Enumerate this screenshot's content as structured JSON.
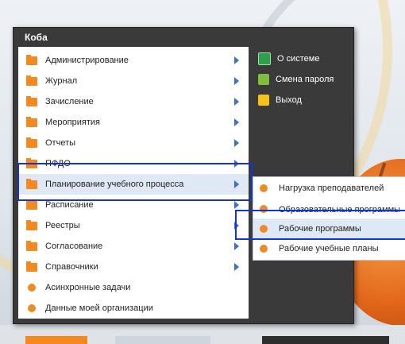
{
  "menu": {
    "title": "Коба",
    "items": [
      {
        "label": "Администрирование",
        "icon": "folder-icon",
        "arrow": true
      },
      {
        "label": "Журнал",
        "icon": "folder-icon",
        "arrow": true
      },
      {
        "label": "Зачисление",
        "icon": "folder-icon",
        "arrow": true
      },
      {
        "label": "Мероприятия",
        "icon": "folder-icon",
        "arrow": true
      },
      {
        "label": "Отчеты",
        "icon": "folder-icon",
        "arrow": true
      },
      {
        "label": "ПФДО",
        "icon": "folder-icon",
        "arrow": true
      },
      {
        "label": "Планирование учебного процесса",
        "icon": "folder-icon",
        "arrow": true,
        "highlighted": true
      },
      {
        "label": "Расписание",
        "icon": "folder-icon",
        "arrow": true
      },
      {
        "label": "Реестры",
        "icon": "folder-icon",
        "arrow": true
      },
      {
        "label": "Согласование",
        "icon": "folder-icon",
        "arrow": true
      },
      {
        "label": "Справочники",
        "icon": "folder-icon",
        "arrow": true
      },
      {
        "label": "Асинхронные задачи",
        "icon": "dot-icon",
        "arrow": false
      },
      {
        "label": "Данные моей организации",
        "icon": "dot-icon",
        "arrow": false
      }
    ],
    "right_items": [
      {
        "label": "О системе",
        "icon": "monitor-icon"
      },
      {
        "label": "Смена пароля",
        "icon": "users-icon"
      },
      {
        "label": "Выход",
        "icon": "key-icon"
      }
    ]
  },
  "submenu": {
    "items": [
      {
        "label": "Нагрузка преподавателей"
      },
      {
        "label": "Образовательные программы"
      },
      {
        "label": "Рабочие программы",
        "highlighted": true
      },
      {
        "label": "Рабочие учебные планы"
      }
    ]
  },
  "colors": {
    "accent": "#f08a22",
    "highlight_box": "#1432d8",
    "menu_bg": "#3a3a3a",
    "arrow": "#3c6fd0"
  }
}
